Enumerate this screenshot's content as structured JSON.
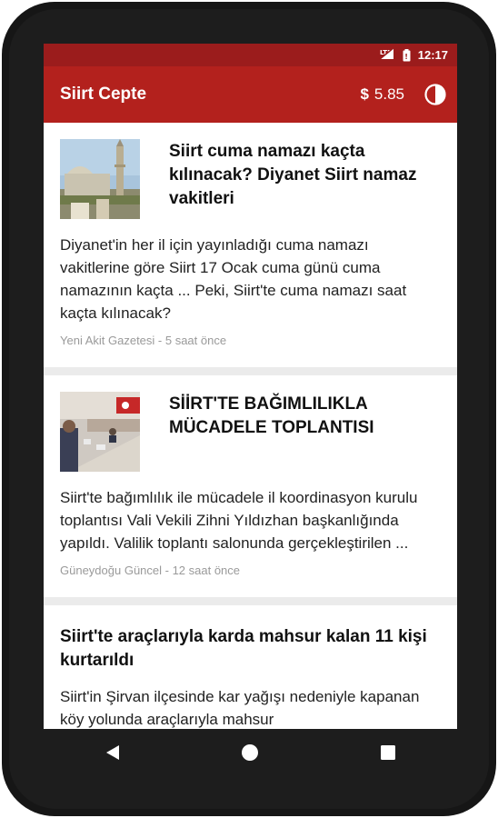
{
  "status_bar": {
    "time": "12:17",
    "icons": [
      "signal-lte-icon",
      "battery-icon"
    ]
  },
  "app_bar": {
    "title": "Siirt Cepte",
    "currency_symbol": "$",
    "exchange_rate": "5.85",
    "theme_icon": "contrast-icon"
  },
  "articles": [
    {
      "title": "Siirt cuma namazı kaçta kılınacak? Diyanet Siirt namaz vakitleri",
      "summary": "Diyanet'in her il için yayınladığı cuma namazı vakitlerine göre Siirt 17 Ocak cuma günü cuma namazının kaçta ... Peki, Siirt'te cuma namazı saat kaçta kılınacak?",
      "source": "Yeni Akit Gazetesi - 5 saat önce",
      "thumbnail": "mosque-minaret-photo"
    },
    {
      "title": "SİİRT'TE BAĞIMLILIKLA MÜCADELE TOPLANTISI",
      "summary": "Siirt'te bağımlılık ile mücadele il koordinasyon kurulu toplantısı Vali Vekili Zihni Yıldızhan başkanlığında yapıldı. Valilik toplantı salonunda gerçekleştirilen ...",
      "source": "Güneydoğu Güncel - 12 saat önce",
      "thumbnail": "meeting-room-photo"
    },
    {
      "title": "Siirt'te araçlarıyla karda mahsur kalan 11 kişi kurtarıldı",
      "summary": "Siirt'in Şirvan ilçesinde kar yağışı nedeniyle kapanan köy yolunda araçlarıyla mahsur"
    }
  ],
  "nav_bar": {
    "icons": [
      "back-icon",
      "home-icon",
      "recents-icon"
    ]
  },
  "colors": {
    "status_bar": "#9b1c1c",
    "app_bar": "#b3211d",
    "background": "#ebebeb"
  }
}
